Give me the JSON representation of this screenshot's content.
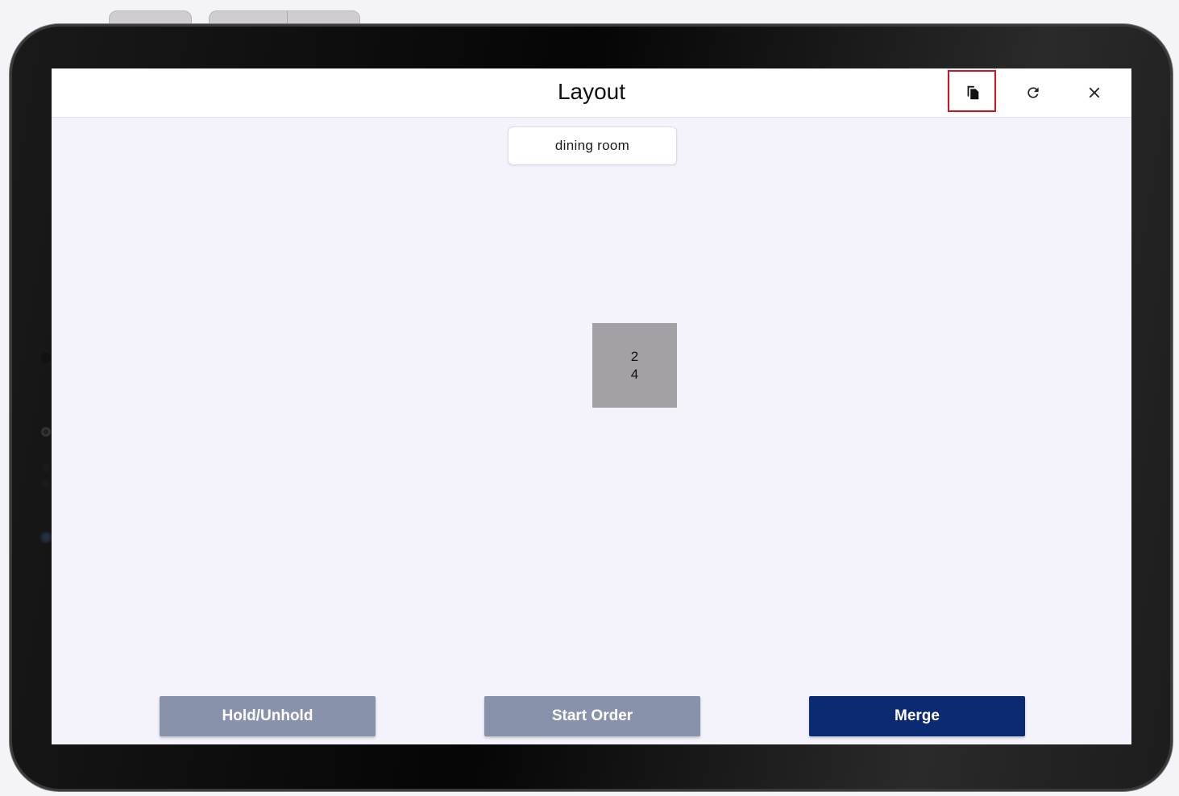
{
  "app": {
    "title": "Layout"
  },
  "toolbar": {
    "icons": [
      "copy-icon",
      "refresh-icon",
      "close-icon"
    ]
  },
  "room_selector": {
    "selected": "dining room"
  },
  "table": {
    "number": "2",
    "seats": "4"
  },
  "actions": {
    "hold_label": "Hold/Unhold",
    "start_label": "Start Order",
    "merge_label": "Merge"
  },
  "colors": {
    "primary": "#0c2a72",
    "disabled_button": "#8992ab",
    "table_tile": "#a3a1a6",
    "highlight": "#d2151c"
  }
}
